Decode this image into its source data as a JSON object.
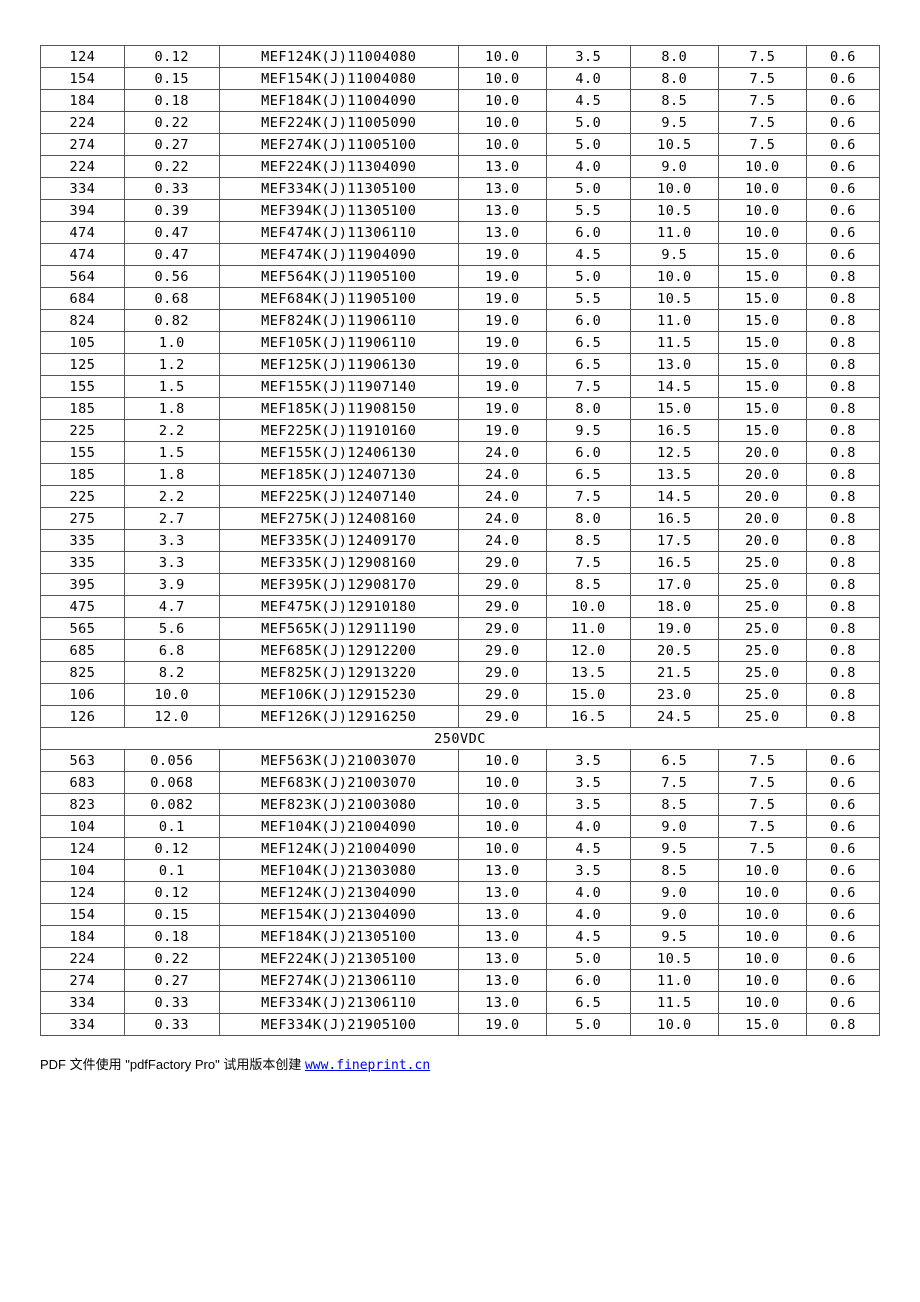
{
  "section_label": "250VDC",
  "rows1": [
    [
      "124",
      "0.12",
      "MEF124K(J)11004080",
      "10.0",
      "3.5",
      "8.0",
      "7.5",
      "0.6"
    ],
    [
      "154",
      "0.15",
      "MEF154K(J)11004080",
      "10.0",
      "4.0",
      "8.0",
      "7.5",
      "0.6"
    ],
    [
      "184",
      "0.18",
      "MEF184K(J)11004090",
      "10.0",
      "4.5",
      "8.5",
      "7.5",
      "0.6"
    ],
    [
      "224",
      "0.22",
      "MEF224K(J)11005090",
      "10.0",
      "5.0",
      "9.5",
      "7.5",
      "0.6"
    ],
    [
      "274",
      "0.27",
      "MEF274K(J)11005100",
      "10.0",
      "5.0",
      "10.5",
      "7.5",
      "0.6"
    ],
    [
      "224",
      "0.22",
      "MEF224K(J)11304090",
      "13.0",
      "4.0",
      "9.0",
      "10.0",
      "0.6"
    ],
    [
      "334",
      "0.33",
      "MEF334K(J)11305100",
      "13.0",
      "5.0",
      "10.0",
      "10.0",
      "0.6"
    ],
    [
      "394",
      "0.39",
      "MEF394K(J)11305100",
      "13.0",
      "5.5",
      "10.5",
      "10.0",
      "0.6"
    ],
    [
      "474",
      "0.47",
      "MEF474K(J)11306110",
      "13.0",
      "6.0",
      "11.0",
      "10.0",
      "0.6"
    ],
    [
      "474",
      "0.47",
      "MEF474K(J)11904090",
      "19.0",
      "4.5",
      "9.5",
      "15.0",
      "0.6"
    ],
    [
      "564",
      "0.56",
      "MEF564K(J)11905100",
      "19.0",
      "5.0",
      "10.0",
      "15.0",
      "0.8"
    ],
    [
      "684",
      "0.68",
      "MEF684K(J)11905100",
      "19.0",
      "5.5",
      "10.5",
      "15.0",
      "0.8"
    ],
    [
      "824",
      "0.82",
      "MEF824K(J)11906110",
      "19.0",
      "6.0",
      "11.0",
      "15.0",
      "0.8"
    ],
    [
      "105",
      "1.0",
      "MEF105K(J)11906110",
      "19.0",
      "6.5",
      "11.5",
      "15.0",
      "0.8"
    ],
    [
      "125",
      "1.2",
      "MEF125K(J)11906130",
      "19.0",
      "6.5",
      "13.0",
      "15.0",
      "0.8"
    ],
    [
      "155",
      "1.5",
      "MEF155K(J)11907140",
      "19.0",
      "7.5",
      "14.5",
      "15.0",
      "0.8"
    ],
    [
      "185",
      "1.8",
      "MEF185K(J)11908150",
      "19.0",
      "8.0",
      "15.0",
      "15.0",
      "0.8"
    ],
    [
      "225",
      "2.2",
      "MEF225K(J)11910160",
      "19.0",
      "9.5",
      "16.5",
      "15.0",
      "0.8"
    ],
    [
      "155",
      "1.5",
      "MEF155K(J)12406130",
      "24.0",
      "6.0",
      "12.5",
      "20.0",
      "0.8"
    ],
    [
      "185",
      "1.8",
      "MEF185K(J)12407130",
      "24.0",
      "6.5",
      "13.5",
      "20.0",
      "0.8"
    ],
    [
      "225",
      "2.2",
      "MEF225K(J)12407140",
      "24.0",
      "7.5",
      "14.5",
      "20.0",
      "0.8"
    ],
    [
      "275",
      "2.7",
      "MEF275K(J)12408160",
      "24.0",
      "8.0",
      "16.5",
      "20.0",
      "0.8"
    ],
    [
      "335",
      "3.3",
      "MEF335K(J)12409170",
      "24.0",
      "8.5",
      "17.5",
      "20.0",
      "0.8"
    ],
    [
      "335",
      "3.3",
      "MEF335K(J)12908160",
      "29.0",
      "7.5",
      "16.5",
      "25.0",
      "0.8"
    ],
    [
      "395",
      "3.9",
      "MEF395K(J)12908170",
      "29.0",
      "8.5",
      "17.0",
      "25.0",
      "0.8"
    ],
    [
      "475",
      "4.7",
      "MEF475K(J)12910180",
      "29.0",
      "10.0",
      "18.0",
      "25.0",
      "0.8"
    ],
    [
      "565",
      "5.6",
      "MEF565K(J)12911190",
      "29.0",
      "11.0",
      "19.0",
      "25.0",
      "0.8"
    ],
    [
      "685",
      "6.8",
      "MEF685K(J)12912200",
      "29.0",
      "12.0",
      "20.5",
      "25.0",
      "0.8"
    ],
    [
      "825",
      "8.2",
      "MEF825K(J)12913220",
      "29.0",
      "13.5",
      "21.5",
      "25.0",
      "0.8"
    ],
    [
      "106",
      "10.0",
      "MEF106K(J)12915230",
      "29.0",
      "15.0",
      "23.0",
      "25.0",
      "0.8"
    ],
    [
      "126",
      "12.0",
      "MEF126K(J)12916250",
      "29.0",
      "16.5",
      "24.5",
      "25.0",
      "0.8"
    ]
  ],
  "rows2": [
    [
      "563",
      "0.056",
      "MEF563K(J)21003070",
      "10.0",
      "3.5",
      "6.5",
      "7.5",
      "0.6"
    ],
    [
      "683",
      "0.068",
      "MEF683K(J)21003070",
      "10.0",
      "3.5",
      "7.5",
      "7.5",
      "0.6"
    ],
    [
      "823",
      "0.082",
      "MEF823K(J)21003080",
      "10.0",
      "3.5",
      "8.5",
      "7.5",
      "0.6"
    ],
    [
      "104",
      "0.1",
      "MEF104K(J)21004090",
      "10.0",
      "4.0",
      "9.0",
      "7.5",
      "0.6"
    ],
    [
      "124",
      "0.12",
      "MEF124K(J)21004090",
      "10.0",
      "4.5",
      "9.5",
      "7.5",
      "0.6"
    ],
    [
      "104",
      "0.1",
      "MEF104K(J)21303080",
      "13.0",
      "3.5",
      "8.5",
      "10.0",
      "0.6"
    ],
    [
      "124",
      "0.12",
      "MEF124K(J)21304090",
      "13.0",
      "4.0",
      "9.0",
      "10.0",
      "0.6"
    ],
    [
      "154",
      "0.15",
      "MEF154K(J)21304090",
      "13.0",
      "4.0",
      "9.0",
      "10.0",
      "0.6"
    ],
    [
      "184",
      "0.18",
      "MEF184K(J)21305100",
      "13.0",
      "4.5",
      "9.5",
      "10.0",
      "0.6"
    ],
    [
      "224",
      "0.22",
      "MEF224K(J)21305100",
      "13.0",
      "5.0",
      "10.5",
      "10.0",
      "0.6"
    ],
    [
      "274",
      "0.27",
      "MEF274K(J)21306110",
      "13.0",
      "6.0",
      "11.0",
      "10.0",
      "0.6"
    ],
    [
      "334",
      "0.33",
      "MEF334K(J)21306110",
      "13.0",
      "6.5",
      "11.5",
      "10.0",
      "0.6"
    ],
    [
      "334",
      "0.33",
      "MEF334K(J)21905100",
      "19.0",
      "5.0",
      "10.0",
      "15.0",
      "0.8"
    ]
  ],
  "footer": {
    "prefix": "PDF 文件使用 \"pdfFactory Pro\" 试用版本创建 ",
    "link_text": "www.fineprint.cn",
    "link_href": "http://www.fineprint.cn"
  }
}
